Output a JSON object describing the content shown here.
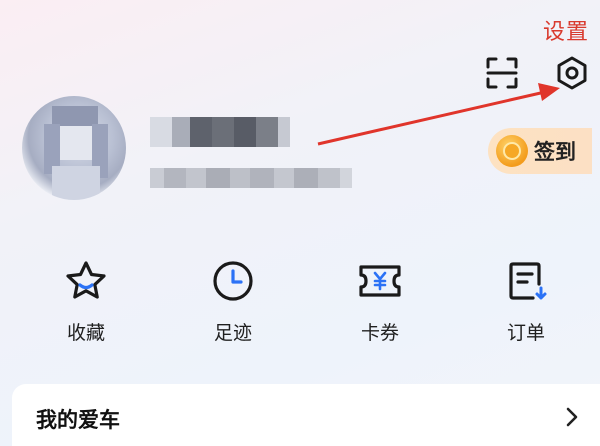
{
  "annotation": {
    "label": "设置",
    "color": "#d93a2e"
  },
  "header": {
    "scan_icon": "scan-icon",
    "settings_icon": "gear-icon"
  },
  "profile": {
    "avatar": "avatar-blurred",
    "username": "",
    "subtitle": ""
  },
  "checkin": {
    "label": "签到",
    "icon": "coin-icon"
  },
  "quick_actions": [
    {
      "label": "收藏",
      "icon": "star-icon"
    },
    {
      "label": "足迹",
      "icon": "clock-icon"
    },
    {
      "label": "卡券",
      "icon": "coupon-icon"
    },
    {
      "label": "订单",
      "icon": "order-icon"
    }
  ],
  "my_car": {
    "title": "我的爱车",
    "chevron": "chevron-right-icon"
  },
  "colors": {
    "accent": "#2b72f6",
    "icon_dark": "#1a1a1a",
    "annotation_red": "#d93a2e"
  }
}
